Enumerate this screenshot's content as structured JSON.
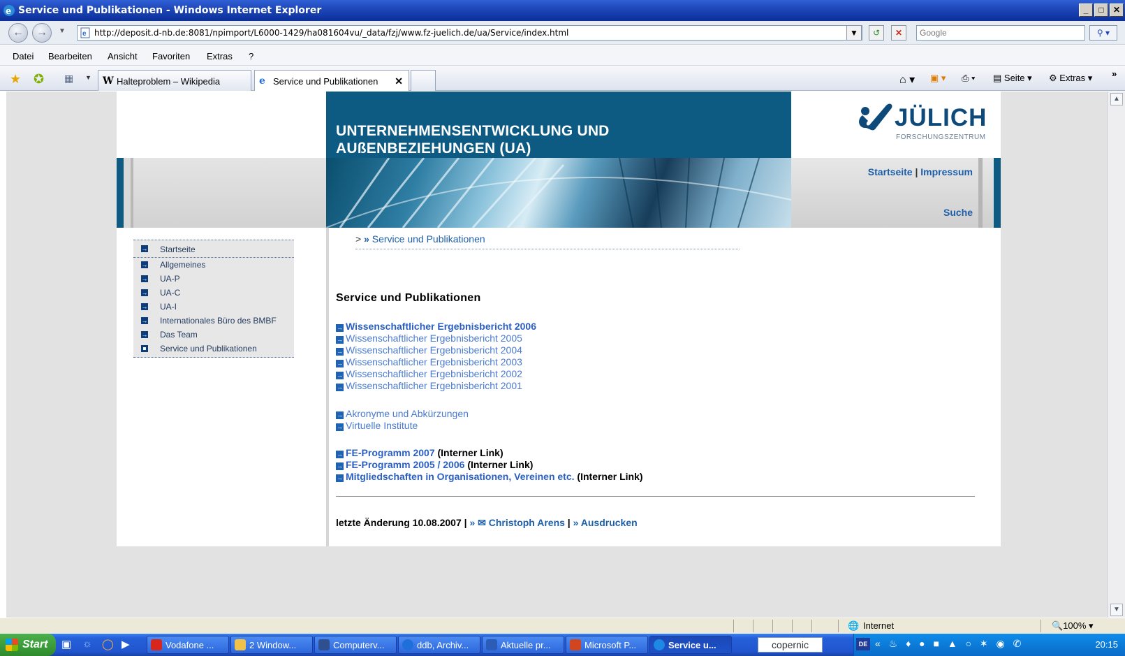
{
  "window": {
    "title": "Service und Publikationen - Windows Internet Explorer",
    "controls": [
      "_",
      "□",
      "✕"
    ]
  },
  "address_bar": {
    "url": "http://deposit.d-nb.de:8081/npimport/L6000-1429/ha081604vu/_data/fzj/www.fz-juelich.de/ua/Service/index.html",
    "search_placeholder": "Google"
  },
  "menu": [
    "Datei",
    "Bearbeiten",
    "Ansicht",
    "Favoriten",
    "Extras",
    "?"
  ],
  "tabs": [
    {
      "label": "Halteproblem – Wikipedia",
      "icon": "W"
    },
    {
      "label": "Service und Publikationen",
      "icon": "e",
      "active": true
    }
  ],
  "commandbar": {
    "page": "Seite",
    "tools": "Extras"
  },
  "site": {
    "unit_title_line1": "UNTERNEHMENSENTWICKLUNG UND",
    "unit_title_line2": "AUßENBEZIEHUNGEN (UA)",
    "logo_brand": "JÜLICH",
    "logo_sub": "FORSCHUNGSZENTRUM",
    "top_links": {
      "home": "Startseite",
      "sep": "|",
      "imprint": "Impressum"
    },
    "search_link": "Suche",
    "sidebar": [
      {
        "label": "Startseite"
      },
      {
        "label": "Allgemeines"
      },
      {
        "label": "UA-P"
      },
      {
        "label": "UA-C"
      },
      {
        "label": "UA-I"
      },
      {
        "label": "Internationales Büro des BMBF"
      },
      {
        "label": "Das Team"
      },
      {
        "label": "Service und Publikationen",
        "current": true
      }
    ],
    "breadcrumb": {
      "prefix": ">",
      "arrow": "»",
      "label": "Service und Publikationen"
    },
    "heading": "Service und Publikationen",
    "reports": [
      {
        "label": "Wissenschaftlicher Ergebnisbericht 2006",
        "bold": true
      },
      {
        "label": "Wissenschaftlicher Ergebnisbericht 2005"
      },
      {
        "label": "Wissenschaftlicher Ergebnisbericht 2004"
      },
      {
        "label": "Wissenschaftlicher Ergebnisbericht 2003"
      },
      {
        "label": "Wissenschaftlicher Ergebnisbericht 2002"
      },
      {
        "label": "Wissenschaftlicher Ergebnisbericht 2001"
      }
    ],
    "misc_links": [
      {
        "label": "Akronyme und Abkürzungen"
      },
      {
        "label": "Virtuelle Institute"
      }
    ],
    "internal_links": [
      {
        "label": "FE-Programm 2007",
        "note": "(Interner Link)"
      },
      {
        "label": "FE-Programm 2005 / 2006",
        "note": "(Interner Link)"
      },
      {
        "label": "Mitgliedschaften in Organisationen, Vereinen etc.",
        "note": "(Interner Link)"
      }
    ],
    "footer": {
      "changed": "letzte Änderung 10.08.2007",
      "sep": "|",
      "contact": "» ✉ Christoph Arens",
      "print": "» Ausdrucken"
    }
  },
  "statusbar": {
    "zone": "Internet",
    "zoom": "100%"
  },
  "taskbar": {
    "start": "Start",
    "buttons": [
      {
        "label": "Vodafone ...",
        "color": "#d9261c"
      },
      {
        "label": "2 Window...",
        "color": "#f0c24a"
      },
      {
        "label": "Computerv...",
        "color": "#2f4f8f"
      },
      {
        "label": "ddb, Archiv...",
        "color": "#1e6fd9"
      },
      {
        "label": "Aktuelle pr...",
        "color": "#2b5db8"
      },
      {
        "label": "Microsoft P...",
        "color": "#d2461f"
      },
      {
        "label": "Service u...",
        "color": "#1e88e5",
        "active": true
      }
    ],
    "search_app": "copernic",
    "lang": "DE",
    "tray_glyphs": "« ♨ ♦ ● ■ ▲ ○ ✶ ◉ ✆",
    "clock": "20:15"
  },
  "colors": {
    "brand_blue": "#0d5a83",
    "link": "#1d5fa8",
    "light_link": "#4a7bd0"
  }
}
